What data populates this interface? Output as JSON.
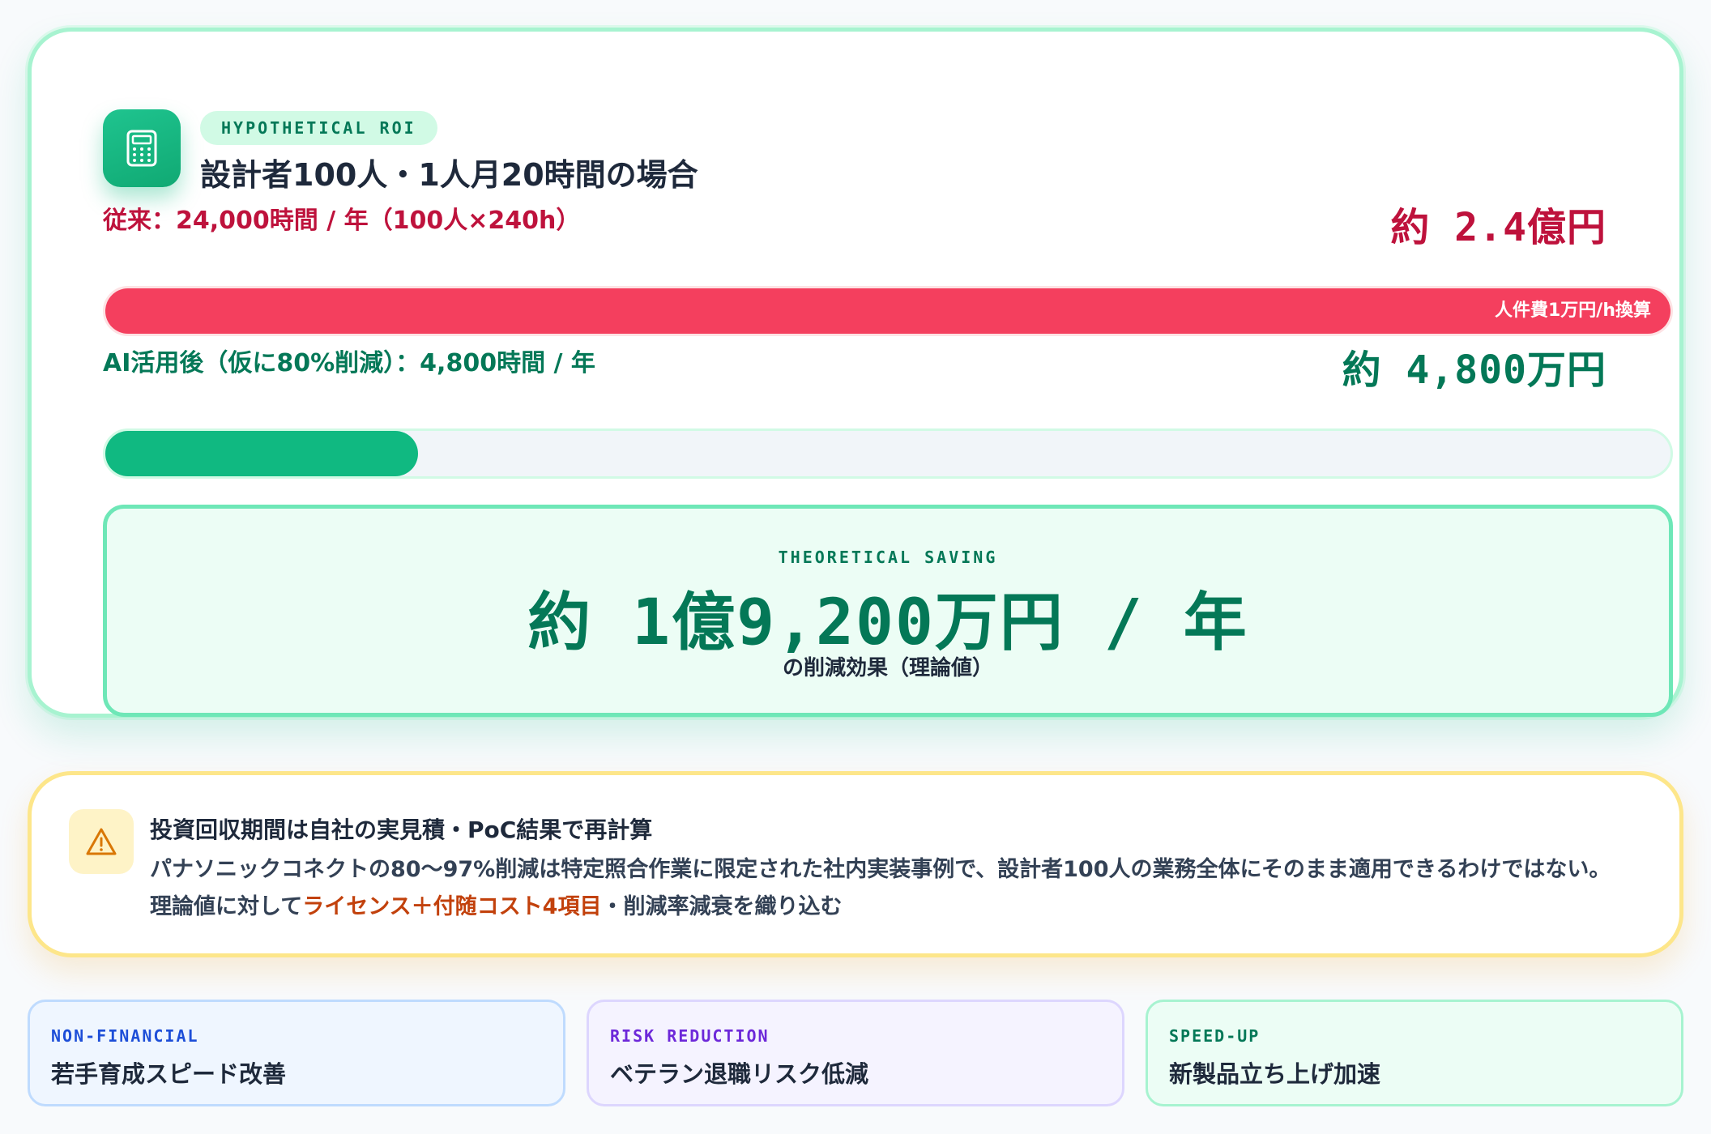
{
  "colors": {
    "accent_green": "#10b981",
    "before_red": "#f43f5e",
    "warning_amber": "#f59e0b"
  },
  "roi": {
    "icon": "calculator-icon",
    "badge": "HYPOTHETICAL ROI",
    "title": "設計者100人・1人月20時間の場合",
    "before": {
      "label": "従来：24,000時間 / 年（100人×240h）",
      "amount": "約 2.4億円",
      "bar_note": "人件費1万円/h換算",
      "bar_fraction": 1.0
    },
    "after": {
      "label": "AI活用後（仮に80%削減）：4,800時間 / 年",
      "amount": "約 4,800万円",
      "bar_fraction": 0.2
    },
    "saving": {
      "label": "THEORETICAL SAVING",
      "value": "約 1億9,200万円 / 年",
      "sub": "の削減効果（理論値）"
    }
  },
  "warning": {
    "icon": "warning-triangle-icon",
    "title": "投資回収期間は自社の実見積・PoC結果で再計算",
    "body_prefix": "パナソニックコネクトの80〜97%削減は特定照合作業に限定された社内実装事例で、設計者100人の業務全体にそのまま適用できるわけではない。理論値に対して",
    "body_highlight": "ライセンス＋付随コスト4項目",
    "body_suffix": "・削減率減衰を織り込む"
  },
  "cards": [
    {
      "tag": "NON-FINANCIAL",
      "title": "若手育成スピード改善"
    },
    {
      "tag": "RISK REDUCTION",
      "title": "ベテラン退職リスク低減"
    },
    {
      "tag": "SPEED-UP",
      "title": "新製品立ち上げ加速"
    }
  ]
}
